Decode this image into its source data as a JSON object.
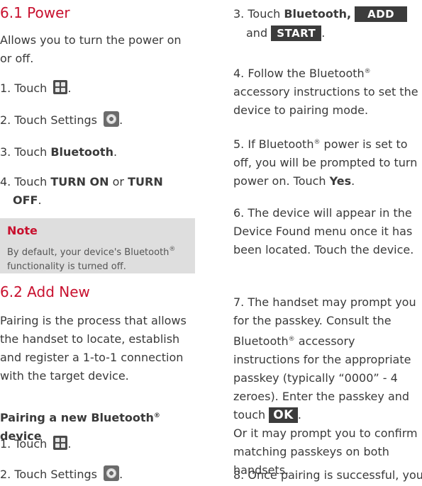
{
  "left": {
    "s61_title": "6.1 Power",
    "s61_intro": "Allows you to turn the power on or off.",
    "s61_step1": "1. Touch ",
    "s61_step2a": "2. Touch ",
    "s61_step2b": "Settings",
    "s61_step3a": "3. Touch ",
    "s61_step3b": "Bluetooth",
    "s61_step3c": ".",
    "s61_step4a": "4. Touch ",
    "s61_step4b": "TURN ON",
    "s61_step4c": " or ",
    "s61_step4d": "TURN",
    "s61_step4e": "OFF",
    "s61_step4f": ".",
    "note_title": "Note",
    "note_text_a": "By default, your device's Bluetooth",
    "note_text_b": "functionality is turned off.",
    "s62_title": "6.2 Add New",
    "s62_intro": "Pairing is the process that allows the handset to locate, establish and register a 1-to-1 connection with the target device.",
    "pairing_heading_a": "Pairing a new Bluetooth",
    "pairing_heading_b": " device",
    "p_step1": "1. Touch ",
    "p_step2a": "2. Touch ",
    "p_step2b": "Settings",
    "reg": "®",
    "dot": "."
  },
  "right": {
    "step3a": "3. Touch ",
    "step3b": "Bluetooth,",
    "step3c": "and",
    "add_label": "ADD",
    "start_label": "START",
    "step4a": "4. Follow the Bluetooth",
    "step4b": "accessory instructions to set the device to pairing mode.",
    "step5a": "5. If Bluetooth",
    "step5b": " power is set to off, you will be prompted to turn power on. Touch ",
    "step5c": "Yes",
    "step5d": ".",
    "step6": "6. The device will appear in the Device Found menu once it has been located. Touch the device.",
    "step7a": "7. The handset may prompt you for the passkey. Consult the Bluetooth",
    "step7b": " accessory instructions for the appropriate passkey (typically “0000” - 4 zeroes). Enter the passkey and touch ",
    "ok_label": "OK",
    "step7c": ".",
    "step7d": "Or it may prompt you to confirm matching passkeys on both handsets.",
    "step8": "8. Once pairing is successful, you",
    "reg": "®"
  },
  "icons": {
    "menu": "menu-grid-icon",
    "settings": "settings-gear-icon"
  },
  "colors": {
    "heading": "#c8102e",
    "note_bg": "#dedede",
    "button_bg": "#3c3c3c"
  }
}
